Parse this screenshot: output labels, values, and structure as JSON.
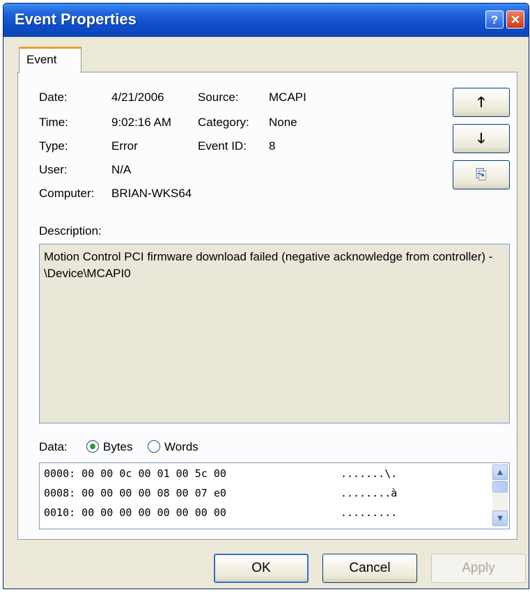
{
  "window": {
    "title": "Event Properties",
    "help_glyph": "?",
    "close_glyph": "✕"
  },
  "tabs": [
    {
      "label": "Event"
    }
  ],
  "fields": {
    "date": {
      "label": "Date:",
      "value": "4/21/2006"
    },
    "time": {
      "label": "Time:",
      "value": "9:02:16 AM"
    },
    "type": {
      "label": "Type:",
      "value": "Error"
    },
    "user": {
      "label": "User:",
      "value": "N/A"
    },
    "computer": {
      "label": "Computer:",
      "value": "BRIAN-WKS64"
    },
    "source": {
      "label": "Source:",
      "value": "MCAPI"
    },
    "category": {
      "label": "Category:",
      "value": "None"
    },
    "event_id": {
      "label": "Event ID:",
      "value": "8"
    }
  },
  "side_buttons": {
    "up_glyph": "🡑",
    "down_glyph": "🡓",
    "copy_glyph": "⎘"
  },
  "description": {
    "label": "Description:",
    "text": "Motion Control PCI firmware download failed (negative acknowledge from controller) - \\Device\\MCAPI0"
  },
  "data": {
    "label": "Data:",
    "options": [
      {
        "label": "Bytes",
        "selected": true
      },
      {
        "label": "Words",
        "selected": false
      }
    ],
    "rows": [
      {
        "hex": "0000: 00 00 0c 00 01 00 5c 00",
        "ascii": ".......\\."
      },
      {
        "hex": "0008: 00 00 00 00 08 00 07 e0",
        "ascii": "........à"
      },
      {
        "hex": "0010: 00 00 00 00 00 00 00 00",
        "ascii": "........."
      }
    ],
    "scroll_up_glyph": "▲",
    "scroll_down_glyph": "▼"
  },
  "buttons": {
    "ok": "OK",
    "cancel": "Cancel",
    "apply": "Apply"
  }
}
